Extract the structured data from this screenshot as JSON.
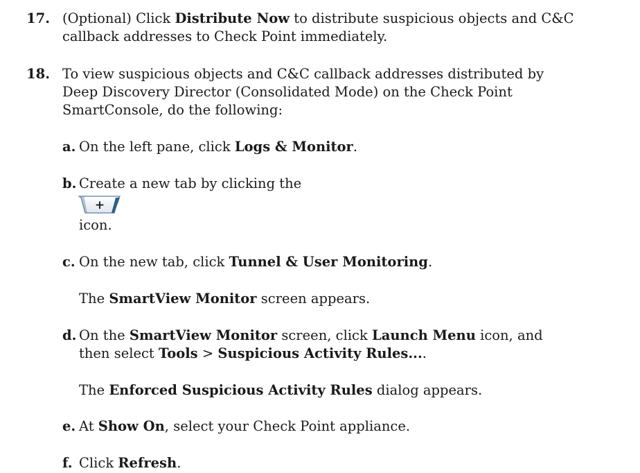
{
  "steps": {
    "s17": {
      "num": "17.",
      "l1_a": "(Optional) Click ",
      "l1_b": "Distribute Now",
      "l1_c": " to distribute suspicious objects and C&C",
      "l2": "callback addresses to Check Point immediately."
    },
    "s18": {
      "num": "18.",
      "l1": "To view suspicious objects and C&C callback addresses distributed by",
      "l2": "Deep Discovery Director (Consolidated Mode) on the Check Point",
      "l3": "SmartConsole, do the following:"
    },
    "a": {
      "letter": "a.",
      "t1": "On the left pane, click ",
      "t2": "Logs & Monitor",
      "t3": "."
    },
    "b": {
      "letter": "b.",
      "t1": "Create a new tab by clicking the",
      "icon_glyph": "+",
      "t2": "icon."
    },
    "c": {
      "letter": "c.",
      "t1": "On the new tab, click ",
      "t2": "Tunnel & User Monitoring",
      "t3": ".",
      "r1": "The ",
      "r2": "SmartView Monitor",
      "r3": " screen appears."
    },
    "d": {
      "letter": "d.",
      "t1": "On the ",
      "t2": "SmartView Monitor",
      "t3": " screen, click ",
      "t4": "Launch Menu",
      "t5": " icon, and",
      "t6": "then select ",
      "t7": "Tools",
      "t8": " > ",
      "t9": "Suspicious Activity Rules...",
      "t10": ".",
      "r1": "The ",
      "r2": "Enforced Suspicious Activity Rules",
      "r3": " dialog appears."
    },
    "e": {
      "letter": "e.",
      "t1": "At ",
      "t2": "Show On",
      "t3": ", select your Check Point appliance."
    },
    "f": {
      "letter": "f.",
      "t1": "Click ",
      "t2": "Refresh",
      "t3": "."
    }
  },
  "icon_name": "new-tab-plus-icon"
}
